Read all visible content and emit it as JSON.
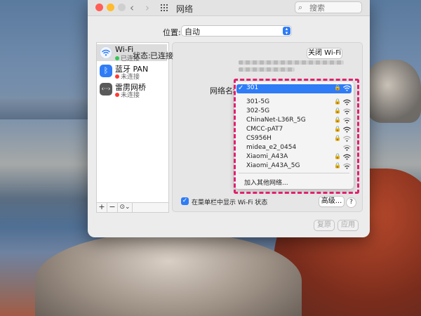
{
  "window": {
    "title": "网络",
    "search_placeholder": "搜索"
  },
  "location": {
    "label": "位置:",
    "value": "自动"
  },
  "sidebar": {
    "items": [
      {
        "name": "Wi-Fi",
        "status": "已连接",
        "status_color": "#34c759",
        "icon": "wifi-icon",
        "selected": true
      },
      {
        "name": "蓝牙 PAN",
        "status": "未连接",
        "status_color": "#ff3b30",
        "icon": "bluetooth-icon",
        "selected": false
      },
      {
        "name": "雷雳网桥",
        "status": "未连接",
        "status_color": "#ff3b30",
        "icon": "thunderbolt-bridge-icon",
        "selected": false
      }
    ],
    "tools": {
      "add": "+",
      "remove": "−",
      "action": "⊙⌄"
    }
  },
  "status": {
    "label": "状态:",
    "value": "已连接",
    "turn_off_button": "关闭 Wi-Fi"
  },
  "network_name": {
    "label": "网络名称:",
    "networks": [
      {
        "name": "301",
        "locked": true,
        "selected": true
      },
      {
        "name": "301-5G",
        "locked": true,
        "selected": false
      },
      {
        "name": "302-5G",
        "locked": true,
        "selected": false
      },
      {
        "name": "ChinaNet-L36R_5G",
        "locked": true,
        "selected": false
      },
      {
        "name": "CMCC-pAT7",
        "locked": true,
        "selected": false
      },
      {
        "name": "CS956H",
        "locked": true,
        "selected": false
      },
      {
        "name": "midea_e2_0454",
        "locked": false,
        "selected": false
      },
      {
        "name": "Xiaomi_A43A",
        "locked": true,
        "selected": false
      },
      {
        "name": "Xiaomi_A43A_5G",
        "locked": true,
        "selected": false
      }
    ],
    "join_other": "加入其他网络..."
  },
  "menubar_option": {
    "label": "在菜单栏中显示 Wi-Fi 状态",
    "checked": true
  },
  "buttons": {
    "advanced": "高级...",
    "help": "?",
    "revert": "复原",
    "apply": "应用"
  },
  "colors": {
    "accent": "#2f7cf6",
    "highlight": "#e0206e"
  }
}
